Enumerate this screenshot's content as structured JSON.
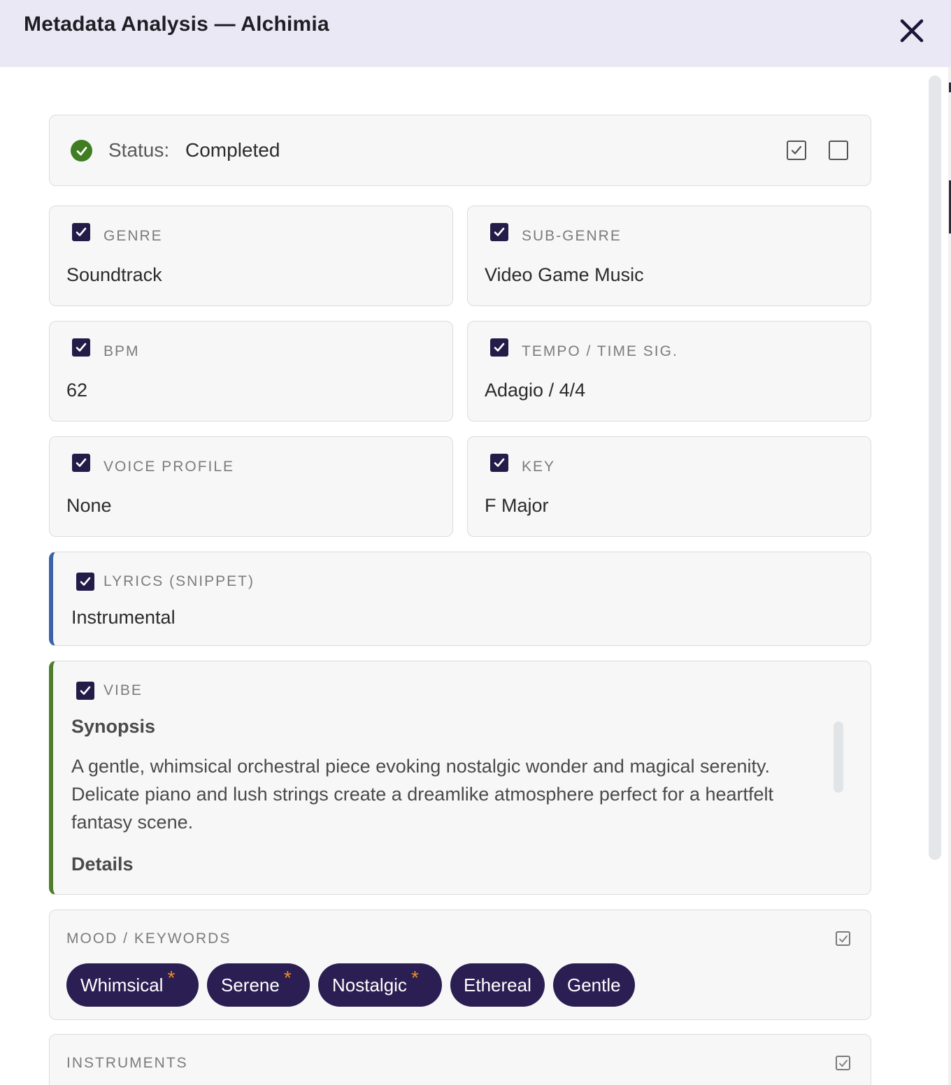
{
  "header": {
    "title": "Metadata Analysis — Alchimia"
  },
  "status": {
    "label": "Status:",
    "value": "Completed"
  },
  "fields": {
    "genre": {
      "label": "GENRE",
      "value": "Soundtrack",
      "checked": true
    },
    "subgenre": {
      "label": "SUB-GENRE",
      "value": "Video Game Music",
      "checked": true
    },
    "bpm": {
      "label": "BPM",
      "value": "62",
      "checked": true
    },
    "tempo": {
      "label": "TEMPO / TIME SIG.",
      "value": "Adagio / 4/4",
      "checked": true
    },
    "voice": {
      "label": "VOICE PROFILE",
      "value": "None",
      "checked": true
    },
    "key": {
      "label": "KEY",
      "value": "F Major",
      "checked": true
    },
    "lyrics": {
      "label": "LYRICS (SNIPPET)",
      "value": "Instrumental",
      "checked": true
    }
  },
  "vibe": {
    "label": "VIBE",
    "synopsis_heading": "Synopsis",
    "synopsis_text": "A gentle, whimsical orchestral piece evoking nostalgic wonder and magical serenity. Delicate piano and lush strings create a dreamlike atmosphere perfect for a heartfelt fantasy scene.",
    "details_heading": "Details"
  },
  "mood": {
    "label": "MOOD / KEYWORDS",
    "chips": [
      {
        "text": "Whimsical",
        "star": "*"
      },
      {
        "text": "Serene",
        "star": "*"
      },
      {
        "text": "Nostalgic",
        "star": "*"
      },
      {
        "text": "Ethereal",
        "star": ""
      },
      {
        "text": "Gentle",
        "star": ""
      }
    ]
  },
  "instruments": {
    "label": "INSTRUMENTS"
  },
  "colors": {
    "header_bg": "#ebe8f5",
    "checkbox": "#241c48",
    "chip_bg": "#2b1e52",
    "chip_star": "#f08a28",
    "status_ok": "#3f7d23",
    "accent_lyrics": "#3a63a8",
    "accent_vibe": "#4f7f2c"
  }
}
